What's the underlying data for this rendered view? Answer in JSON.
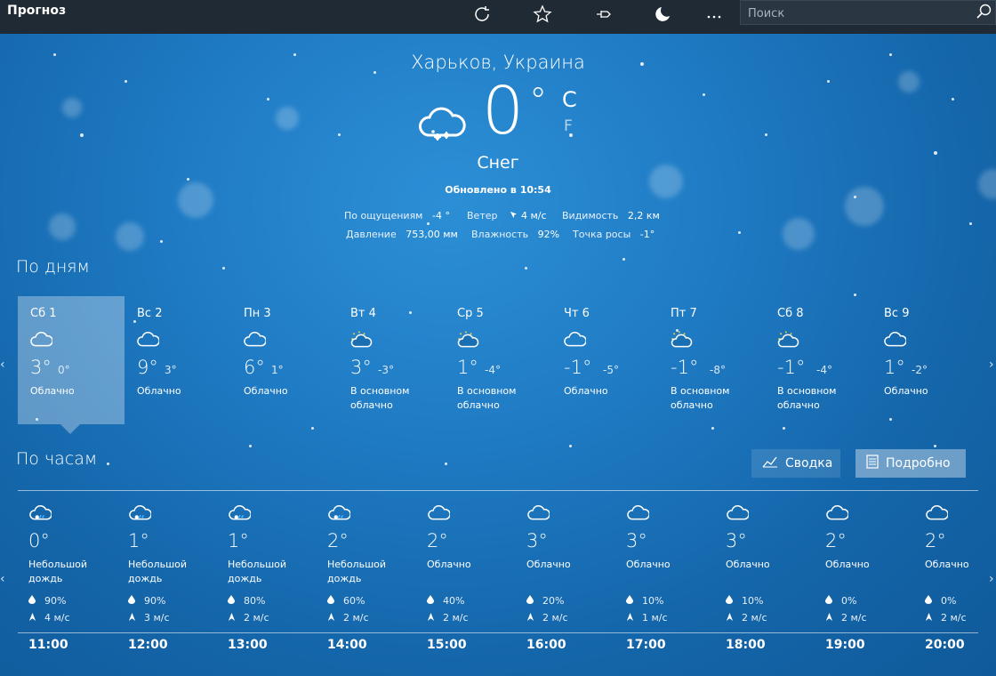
{
  "app": {
    "title": "Прогноз",
    "search_placeholder": "Поиск"
  },
  "icons": [
    "refresh-icon",
    "favorite-star-icon",
    "pin-icon",
    "moon-icon",
    "more-icon",
    "search-icon"
  ],
  "current": {
    "location": "Харьков, Украина",
    "temp": "0",
    "degree": "°",
    "unit_c": "C",
    "unit_f": "F",
    "condition": "Снег",
    "updated": "Обновлено в 10:54",
    "feels_label": "По ощущениям",
    "feels_value": "-4 °",
    "wind_label": "Ветер",
    "wind_value": "4 м/с",
    "visibility_label": "Видимость",
    "visibility_value": "2,2 км",
    "pressure_label": "Давление",
    "pressure_value": "753,00 мм",
    "humidity_label": "Влажность",
    "humidity_value": "92%",
    "dew_label": "Точка росы",
    "dew_value": "-1°"
  },
  "daily": {
    "title": "По дням",
    "days": [
      {
        "name": "Сб 1",
        "hi": "3°",
        "lo": "0°",
        "cond": "Облачно",
        "icon": "cloud"
      },
      {
        "name": "Вс 2",
        "hi": "9°",
        "lo": "3°",
        "cond": "Облачно",
        "icon": "cloud"
      },
      {
        "name": "Пн 3",
        "hi": "6°",
        "lo": "1°",
        "cond": "Облачно",
        "icon": "cloud"
      },
      {
        "name": "Вт 4",
        "hi": "3°",
        "lo": "-3°",
        "cond": "В основном облачно",
        "icon": "suncloud"
      },
      {
        "name": "Ср 5",
        "hi": "1°",
        "lo": "-4°",
        "cond": "В основном облачно",
        "icon": "suncloud"
      },
      {
        "name": "Чт 6",
        "hi": "-1°",
        "lo": "-5°",
        "cond": "Облачно",
        "icon": "cloud"
      },
      {
        "name": "Пт 7",
        "hi": "-1°",
        "lo": "-8°",
        "cond": "В основном облачно",
        "icon": "suncloud"
      },
      {
        "name": "Сб 8",
        "hi": "-1°",
        "lo": "-4°",
        "cond": "В основном облачно",
        "icon": "suncloud"
      },
      {
        "name": "Вс 9",
        "hi": "1°",
        "lo": "-2°",
        "cond": "Облачно",
        "icon": "cloud"
      }
    ]
  },
  "hourly": {
    "title": "По часам",
    "summary_label": "Сводка",
    "detailed_label": "Подробно",
    "hours": [
      {
        "time": "11:00",
        "temp": "0°",
        "cond": "Небольшой дождь",
        "rain": "90%",
        "wind": "4 м/с",
        "icon": "rain"
      },
      {
        "time": "12:00",
        "temp": "1°",
        "cond": "Небольшой дождь",
        "rain": "90%",
        "wind": "3 м/с",
        "icon": "rain"
      },
      {
        "time": "13:00",
        "temp": "1°",
        "cond": "Небольшой дождь",
        "rain": "80%",
        "wind": "2 м/с",
        "icon": "rain"
      },
      {
        "time": "14:00",
        "temp": "2°",
        "cond": "Небольшой дождь",
        "rain": "60%",
        "wind": "2 м/с",
        "icon": "rain"
      },
      {
        "time": "15:00",
        "temp": "2°",
        "cond": "Облачно",
        "rain": "40%",
        "wind": "2 м/с",
        "icon": "cloud"
      },
      {
        "time": "16:00",
        "temp": "3°",
        "cond": "Облачно",
        "rain": "20%",
        "wind": "2 м/с",
        "icon": "cloud"
      },
      {
        "time": "17:00",
        "temp": "3°",
        "cond": "Облачно",
        "rain": "10%",
        "wind": "1 м/с",
        "icon": "cloud"
      },
      {
        "time": "18:00",
        "temp": "3°",
        "cond": "Облачно",
        "rain": "10%",
        "wind": "2 м/с",
        "icon": "cloud"
      },
      {
        "time": "19:00",
        "temp": "2°",
        "cond": "Облачно",
        "rain": "0%",
        "wind": "2 м/с",
        "icon": "cloud"
      },
      {
        "time": "20:00",
        "temp": "2°",
        "cond": "Облачно",
        "rain": "0%",
        "wind": "2 м/с",
        "icon": "cloud"
      }
    ]
  }
}
